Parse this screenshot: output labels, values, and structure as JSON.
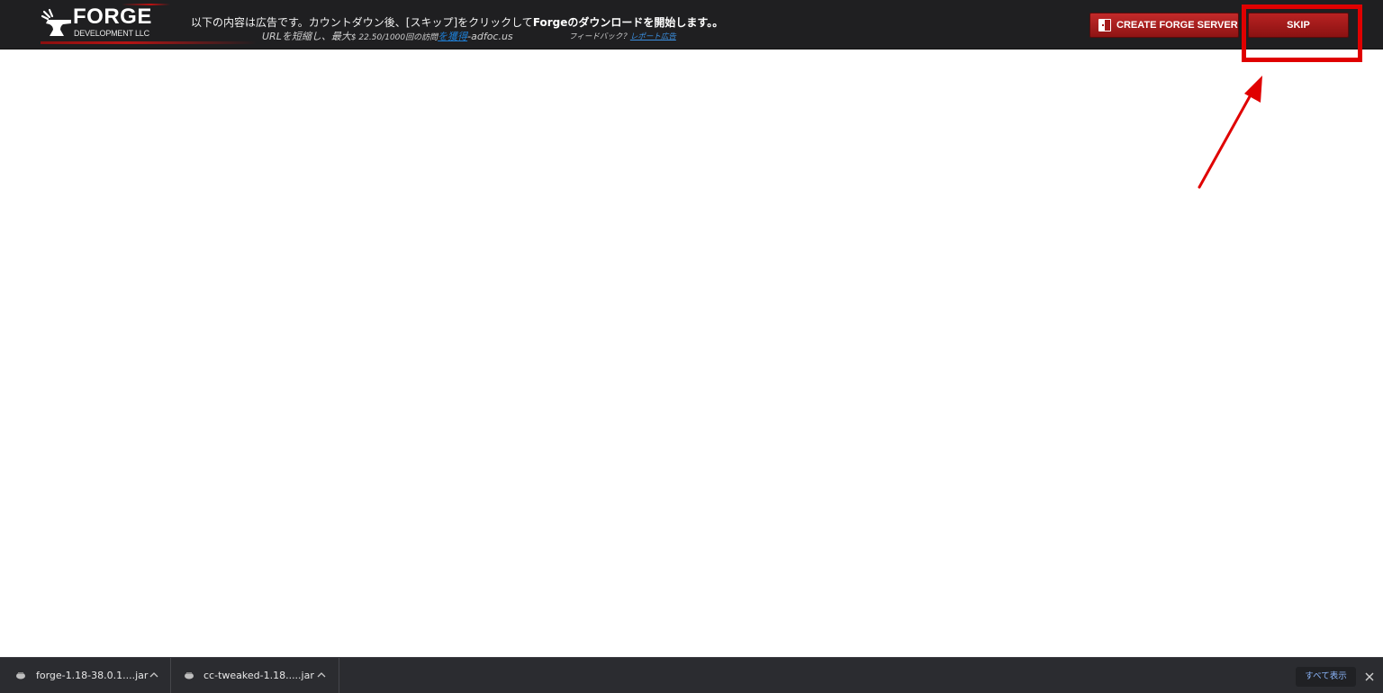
{
  "ad_bar": {
    "logo": {
      "name": "FORGE",
      "subtitle": "DEVELOPMENT LLC"
    },
    "notice": {
      "prefix": "以下の内容は広告です。カウントダウン後、[スキップ]をクリックして",
      "bold": "Forgeのダウンロードを開始します。。"
    },
    "subline": {
      "text1": "URLを短縮し、最大",
      "amount": "$ 22.50/1000回の訪問",
      "earn_link": "を獲得",
      "text2": "-adfoc.us"
    },
    "feedback": {
      "label": "フィードバック？",
      "report_link": "レポート広告"
    },
    "create_server_label": "CREATE FORGE SERVER",
    "skip_label": "SKIP"
  },
  "annotation": {
    "color": "#e00000"
  },
  "downloads": {
    "items": [
      {
        "filename": "forge-1.18-38.0.1....jar"
      },
      {
        "filename": "cc-tweaked-1.18.....jar"
      }
    ],
    "show_all_label": "すべて表示"
  },
  "colors": {
    "bar_bg": "#1f1f21",
    "button_red": "#b82222",
    "link_blue": "#1e7fd6",
    "shelf_bg": "#2b2c30"
  }
}
